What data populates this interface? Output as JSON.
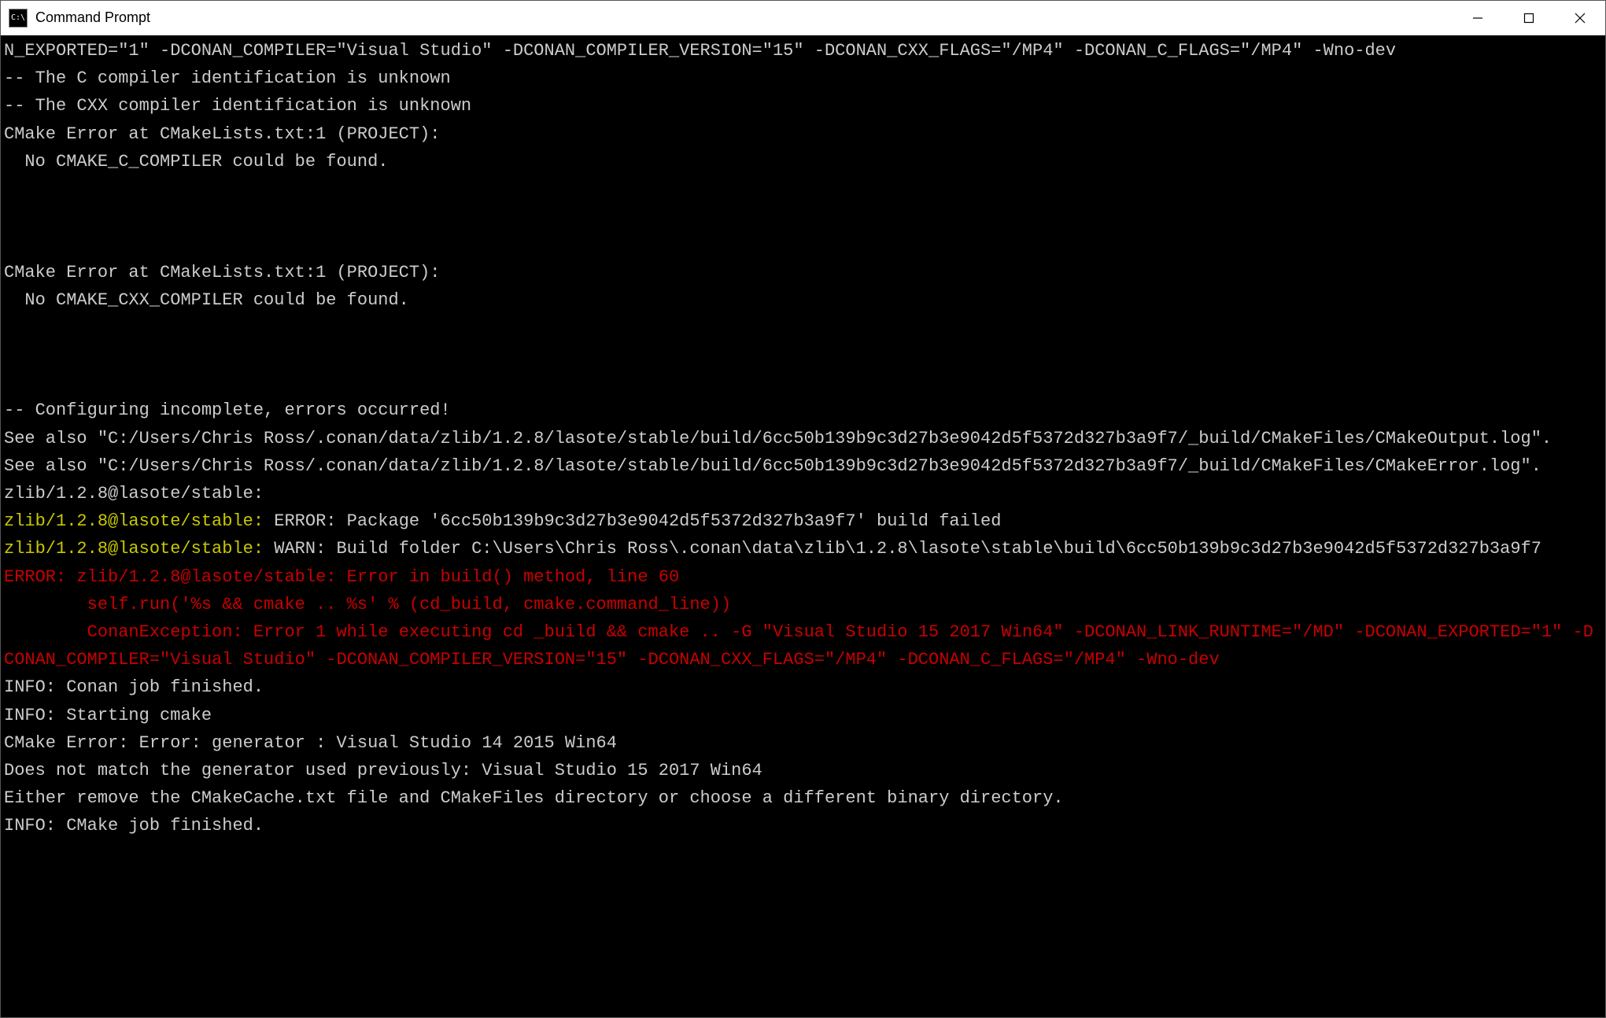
{
  "window": {
    "icon_text": "C:\\",
    "title": "Command Prompt"
  },
  "terminal": {
    "lines": [
      {
        "segments": [
          {
            "cls": "white",
            "text": "N_EXPORTED=\"1\" -DCONAN_COMPILER=\"Visual Studio\" -DCONAN_COMPILER_VERSION=\"15\" -DCONAN_CXX_FLAGS=\"/MP4\" -DCONAN_C_FLAGS=\"/MP4\" -Wno-dev"
          }
        ]
      },
      {
        "segments": [
          {
            "cls": "white",
            "text": "-- The C compiler identification is unknown"
          }
        ]
      },
      {
        "segments": [
          {
            "cls": "white",
            "text": "-- The CXX compiler identification is unknown"
          }
        ]
      },
      {
        "segments": [
          {
            "cls": "white",
            "text": "CMake Error at CMakeLists.txt:1 (PROJECT):"
          }
        ]
      },
      {
        "segments": [
          {
            "cls": "white",
            "text": "  No CMAKE_C_COMPILER could be found."
          }
        ]
      },
      {
        "segments": [
          {
            "cls": "white",
            "text": ""
          }
        ]
      },
      {
        "segments": [
          {
            "cls": "white",
            "text": ""
          }
        ]
      },
      {
        "segments": [
          {
            "cls": "white",
            "text": ""
          }
        ]
      },
      {
        "segments": [
          {
            "cls": "white",
            "text": "CMake Error at CMakeLists.txt:1 (PROJECT):"
          }
        ]
      },
      {
        "segments": [
          {
            "cls": "white",
            "text": "  No CMAKE_CXX_COMPILER could be found."
          }
        ]
      },
      {
        "segments": [
          {
            "cls": "white",
            "text": ""
          }
        ]
      },
      {
        "segments": [
          {
            "cls": "white",
            "text": ""
          }
        ]
      },
      {
        "segments": [
          {
            "cls": "white",
            "text": ""
          }
        ]
      },
      {
        "segments": [
          {
            "cls": "white",
            "text": "-- Configuring incomplete, errors occurred!"
          }
        ]
      },
      {
        "segments": [
          {
            "cls": "white",
            "text": "See also \"C:/Users/Chris Ross/.conan/data/zlib/1.2.8/lasote/stable/build/6cc50b139b9c3d27b3e9042d5f5372d327b3a9f7/_build/CMakeFiles/CMakeOutput.log\"."
          }
        ]
      },
      {
        "segments": [
          {
            "cls": "white",
            "text": "See also \"C:/Users/Chris Ross/.conan/data/zlib/1.2.8/lasote/stable/build/6cc50b139b9c3d27b3e9042d5f5372d327b3a9f7/_build/CMakeFiles/CMakeError.log\"."
          }
        ]
      },
      {
        "segments": [
          {
            "cls": "white",
            "text": "zlib/1.2.8@lasote/stable:"
          }
        ]
      },
      {
        "segments": [
          {
            "cls": "yellow",
            "text": "zlib/1.2.8@lasote/stable: "
          },
          {
            "cls": "white",
            "text": "ERROR: Package '6cc50b139b9c3d27b3e9042d5f5372d327b3a9f7' build failed"
          }
        ]
      },
      {
        "segments": [
          {
            "cls": "yellow",
            "text": "zlib/1.2.8@lasote/stable: "
          },
          {
            "cls": "white",
            "text": "WARN: Build folder C:\\Users\\Chris Ross\\.conan\\data\\zlib\\1.2.8\\lasote\\stable\\build\\6cc50b139b9c3d27b3e9042d5f5372d327b3a9f7"
          }
        ]
      },
      {
        "segments": [
          {
            "cls": "red",
            "text": "ERROR: zlib/1.2.8@lasote/stable: Error in build() method, line 60"
          }
        ]
      },
      {
        "segments": [
          {
            "cls": "red",
            "text": "        self.run('%s && cmake .. %s' % (cd_build, cmake.command_line))"
          }
        ]
      },
      {
        "segments": [
          {
            "cls": "red",
            "text": "        ConanException: Error 1 while executing cd _build && cmake .. -G \"Visual Studio 15 2017 Win64\" -DCONAN_LINK_RUNTIME=\"/MD\" -DCONAN_EXPORTED=\"1\" -DCONAN_COMPILER=\"Visual Studio\" -DCONAN_COMPILER_VERSION=\"15\" -DCONAN_CXX_FLAGS=\"/MP4\" -DCONAN_C_FLAGS=\"/MP4\" -Wno-dev"
          }
        ]
      },
      {
        "segments": [
          {
            "cls": "white",
            "text": "INFO: Conan job finished."
          }
        ]
      },
      {
        "segments": [
          {
            "cls": "white",
            "text": "INFO: Starting cmake"
          }
        ]
      },
      {
        "segments": [
          {
            "cls": "white",
            "text": "CMake Error: Error: generator : Visual Studio 14 2015 Win64"
          }
        ]
      },
      {
        "segments": [
          {
            "cls": "white",
            "text": "Does not match the generator used previously: Visual Studio 15 2017 Win64"
          }
        ]
      },
      {
        "segments": [
          {
            "cls": "white",
            "text": "Either remove the CMakeCache.txt file and CMakeFiles directory or choose a different binary directory."
          }
        ]
      },
      {
        "segments": [
          {
            "cls": "white",
            "text": "INFO: CMake job finished."
          }
        ]
      }
    ]
  }
}
